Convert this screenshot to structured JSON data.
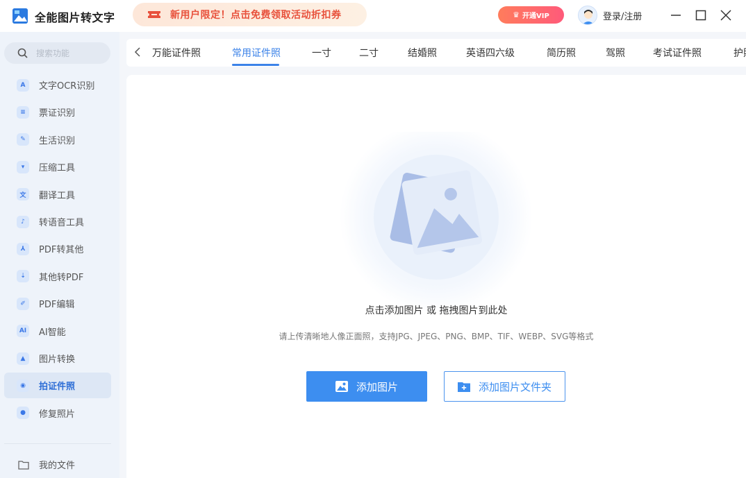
{
  "app": {
    "title": "全能图片转文字",
    "promo_text": "新用户限定！点击免费领取活动折扣券",
    "vip_label": "开通VIP",
    "login_label": "登录/注册"
  },
  "sidebar": {
    "search_placeholder": "搜索功能",
    "items": [
      {
        "label": "文字OCR识别",
        "icon": "ocr-icon",
        "glyph": "A"
      },
      {
        "label": "票证识别",
        "icon": "ticket-icon",
        "glyph": "≡"
      },
      {
        "label": "生活识别",
        "icon": "pen-icon",
        "glyph": "✎"
      },
      {
        "label": "压缩工具",
        "icon": "compress-icon",
        "glyph": "▾"
      },
      {
        "label": "翻译工具",
        "icon": "translate-icon",
        "glyph": "文"
      },
      {
        "label": "转语音工具",
        "icon": "music-icon",
        "glyph": "♪"
      },
      {
        "label": "PDF转其他",
        "icon": "pdf-convert-icon",
        "glyph": "⅄"
      },
      {
        "label": "其他转PDF",
        "icon": "to-pdf-icon",
        "glyph": "⇣"
      },
      {
        "label": "PDF编辑",
        "icon": "pdf-edit-icon",
        "glyph": "✐"
      },
      {
        "label": "AI智能",
        "icon": "ai-icon",
        "glyph": "AI"
      },
      {
        "label": "图片转换",
        "icon": "image-convert-icon",
        "glyph": "▲"
      },
      {
        "label": "拍证件照",
        "icon": "camera-icon",
        "glyph": "◉"
      },
      {
        "label": "修复照片",
        "icon": "repair-icon",
        "glyph": "●"
      }
    ],
    "active_index": 11,
    "my_files_label": "我的文件"
  },
  "tabs": {
    "items": [
      "万能证件照",
      "常用证件照",
      "一寸",
      "二寸",
      "结婚照",
      "英语四六级",
      "简历照",
      "驾照",
      "考试证件照",
      "护照"
    ],
    "active_index": 1
  },
  "main": {
    "drop_title": "点击添加图片 或 拖拽图片到此处",
    "drop_hint": "请上传清晰地人像正面照，支持JPG、JPEG、PNG、BMP、TIF、WEBP、SVG等格式",
    "add_image_label": "添加图片",
    "add_folder_label": "添加图片文件夹"
  },
  "colors": {
    "accent": "#3d8ef0",
    "promo_text": "#e8513c",
    "sidebar_bg": "#eef3fa"
  }
}
